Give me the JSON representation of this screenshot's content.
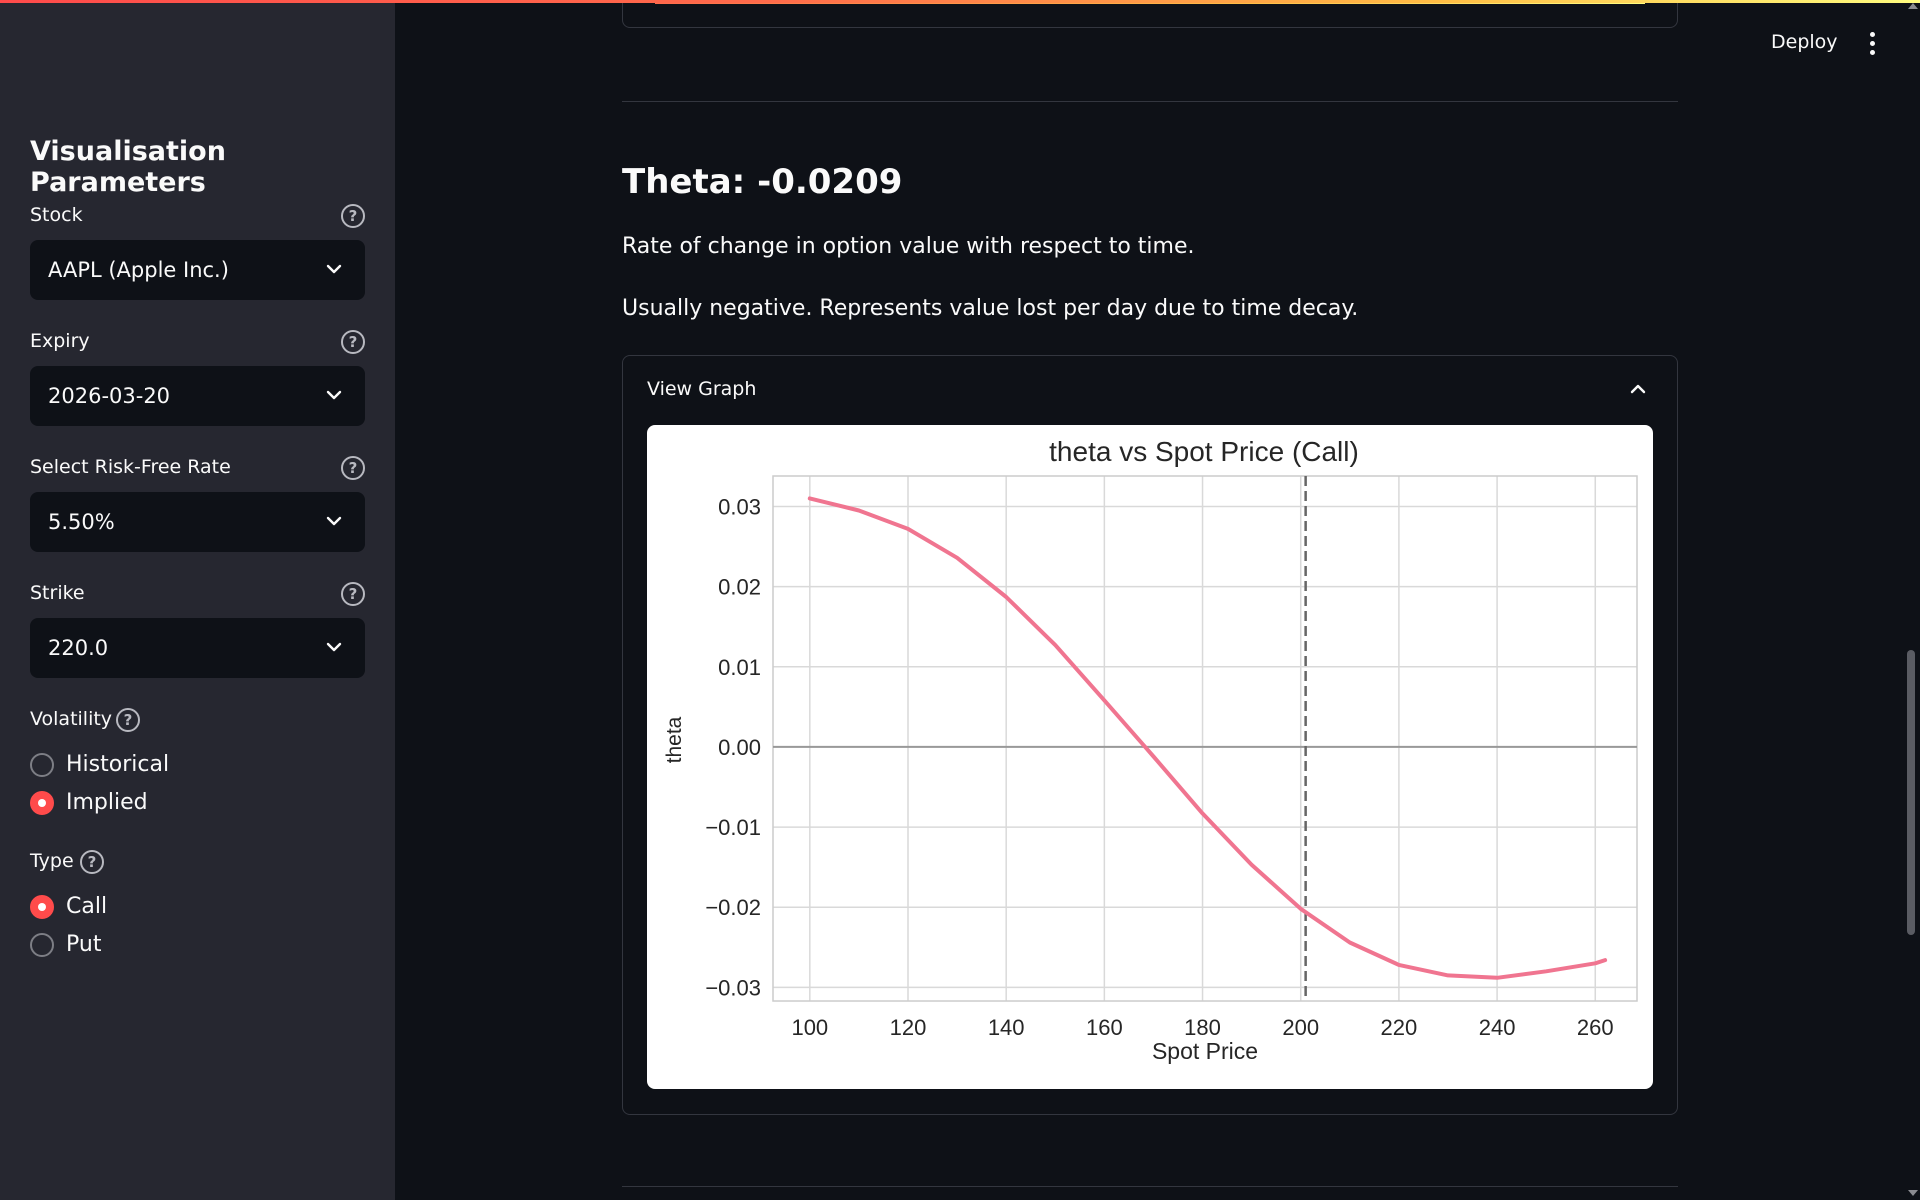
{
  "header": {
    "deploy_label": "Deploy"
  },
  "sidebar": {
    "title": "Visualisation Parameters",
    "stock": {
      "label": "Stock",
      "value": "AAPL (Apple Inc.)"
    },
    "expiry": {
      "label": "Expiry",
      "value": "2026-03-20"
    },
    "rate": {
      "label": "Select Risk-Free Rate",
      "value": "5.50%"
    },
    "strike": {
      "label": "Strike",
      "value": "220.0"
    },
    "volatility": {
      "label": "Volatility",
      "options": [
        "Historical",
        "Implied"
      ],
      "selected": "Implied"
    },
    "type": {
      "label": "Type",
      "options": [
        "Call",
        "Put"
      ],
      "selected": "Call"
    }
  },
  "main": {
    "heading": "Theta: -0.0209",
    "description1": "Rate of change in option value with respect to time.",
    "description2": "Usually negative. Represents value lost per day due to time decay.",
    "expander_label": "View Graph"
  },
  "colors": {
    "accent": "#ff4b4b",
    "line": "#f07590",
    "sidebar_bg": "#262730",
    "main_bg": "#0e1117"
  },
  "chart_data": {
    "type": "line",
    "title": "theta vs Spot Price (Call)",
    "xlabel": "Spot Price",
    "ylabel": "theta",
    "xlim": [
      92.5,
      268.5
    ],
    "ylim": [
      -0.0317,
      0.0338
    ],
    "xticks": [
      100,
      120,
      140,
      160,
      180,
      200,
      220,
      240,
      260
    ],
    "yticks": [
      0.03,
      0.02,
      0.01,
      0.0,
      -0.01,
      -0.02,
      -0.03
    ],
    "ytick_labels": [
      "0.03",
      "0.02",
      "0.01",
      "0.00",
      "−0.01",
      "−0.02",
      "−0.03"
    ],
    "grid": true,
    "reference_lines": {
      "horizontal_y": 0.0,
      "vertical_dashed_x": 201
    },
    "series": [
      {
        "x": [
          100,
          110,
          120,
          130,
          140,
          150,
          160,
          170,
          180,
          190,
          200,
          210,
          220,
          230,
          240,
          250,
          260,
          262
        ],
        "y": [
          0.031,
          0.0295,
          0.0272,
          0.0236,
          0.0187,
          0.0127,
          0.0058,
          -0.0012,
          -0.0083,
          -0.0147,
          -0.0202,
          -0.0244,
          -0.0272,
          -0.0285,
          -0.0288,
          -0.028,
          -0.027,
          -0.0266
        ]
      }
    ]
  }
}
